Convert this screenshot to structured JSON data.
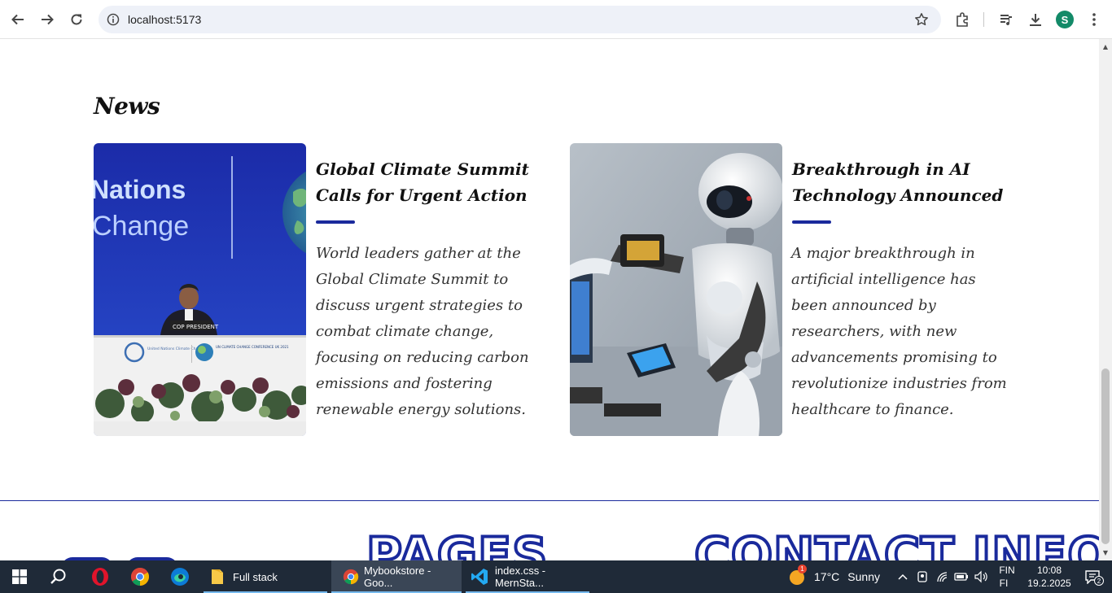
{
  "browser": {
    "url": "localhost:5173",
    "profile_initial": "S",
    "icons": [
      "back-icon",
      "forward-icon",
      "reload-icon",
      "site-info-icon",
      "bookmark-star-icon",
      "extensions-icon",
      "media-icon",
      "downloads-icon",
      "menu-icon"
    ]
  },
  "news": {
    "heading": "News",
    "articles": [
      {
        "title": "Global Climate Summit Calls for Urgent Action",
        "body": "World leaders gather at the Global Climate Summit to discuss urgent strategies to combat climate change, focusing on reducing carbon emissions and fostering renewable energy solutions.",
        "image": {
          "banner_line1": "Nations",
          "banner_line2": "Change",
          "podium_label": "COP PRESIDENT",
          "logo_text": "United Nations Climate Change",
          "logo_text2": "UN CLIMATE CHANGE CONFERENCE UK 2021"
        }
      },
      {
        "title": "Breakthrough in AI Technology Announced",
        "body": "A major breakthrough in artificial intelligence has been announced by researchers, with new advancements promising to revolutionize industries from healthcare to finance.",
        "image": {}
      }
    ]
  },
  "footer": {
    "pages_heading": "PAGES",
    "contact_heading": "CONTACT INFO"
  },
  "taskbar": {
    "apps": [
      {
        "label": "Full stack",
        "icon": "folder-icon"
      },
      {
        "label": "Mybookstore - Goo...",
        "icon": "chrome-icon"
      },
      {
        "label": "index.css - MernSta...",
        "icon": "vscode-icon"
      }
    ],
    "weather": {
      "temp": "17°C",
      "condition": "Sunny",
      "badge": "1"
    },
    "language": {
      "line1": "FIN",
      "line2": "FI"
    },
    "time": "10:08",
    "date": "19.2.2025",
    "notifications": "2"
  },
  "colors": {
    "accent": "#1a2a9c",
    "taskbar": "#1f2a38",
    "omnibox": "#eef1f8"
  }
}
